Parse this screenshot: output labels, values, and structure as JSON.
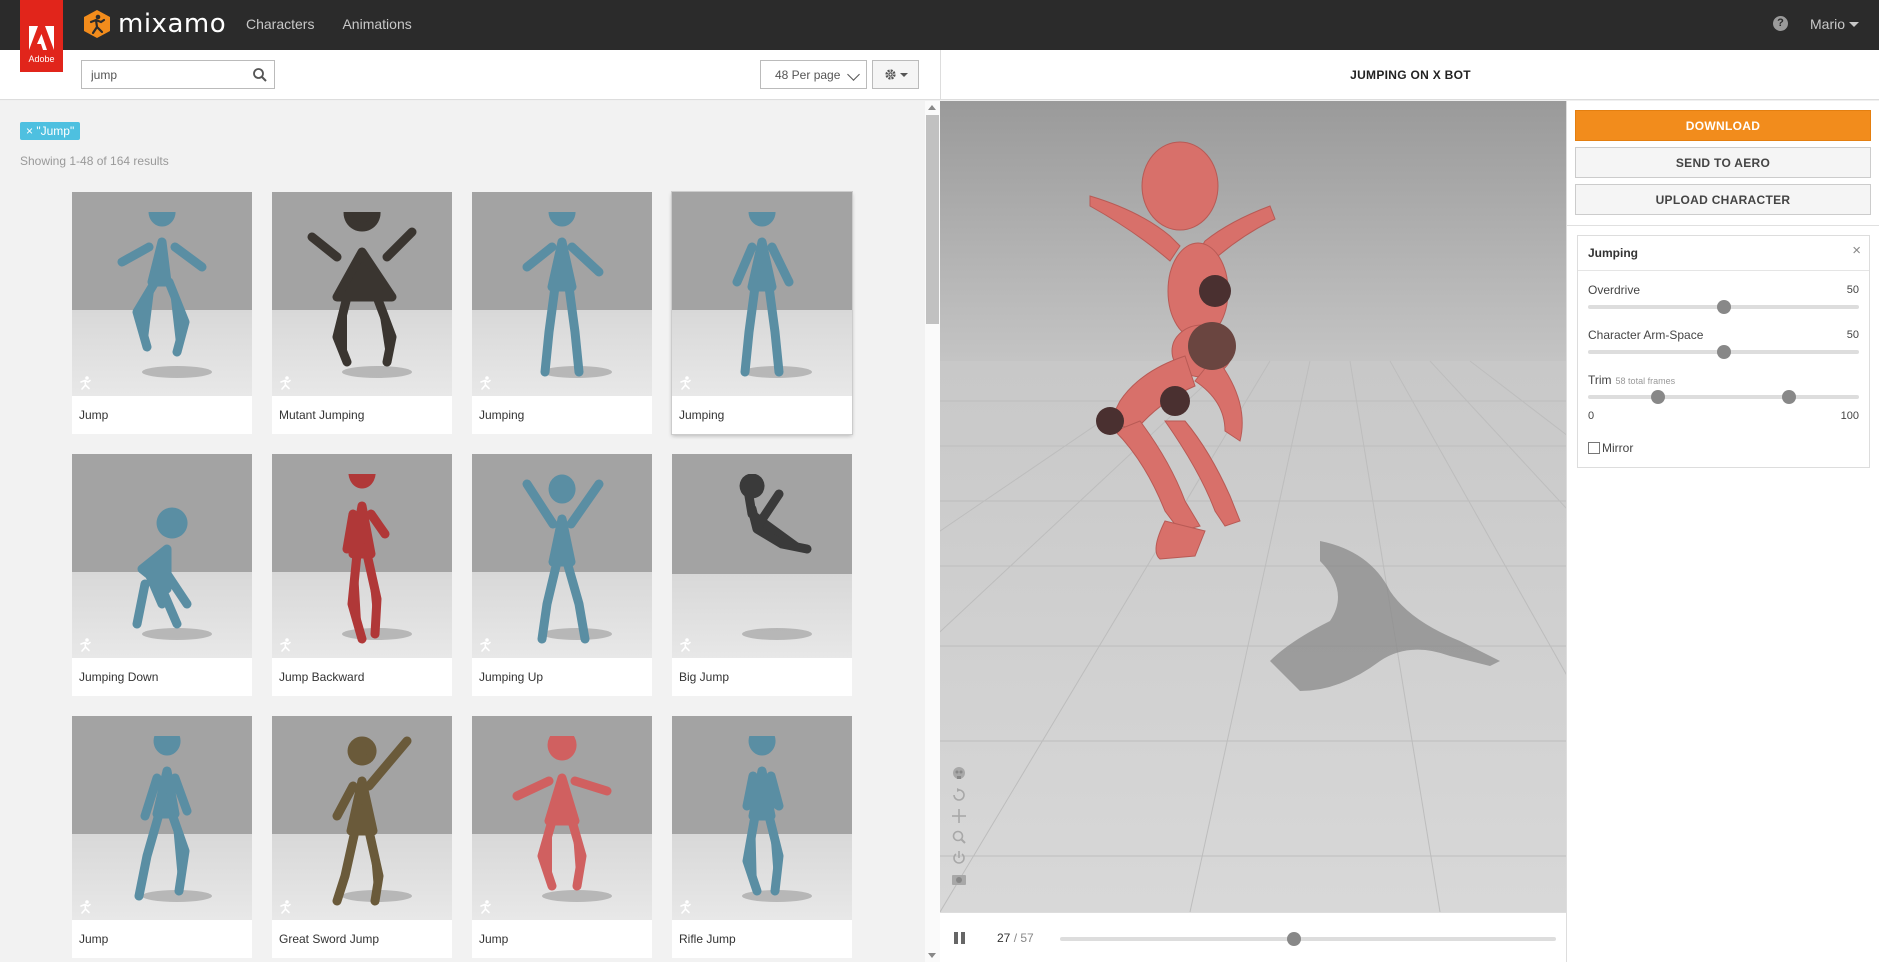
{
  "brand": {
    "adobe_label": "Adobe",
    "app_name": "mixamo",
    "colors": {
      "adobe_red": "#e1251b",
      "accent_orange": "#f28c1c",
      "tag_blue": "#4ec0e0",
      "topbar": "#2b2b2b"
    }
  },
  "nav": {
    "characters": "Characters",
    "animations": "Animations"
  },
  "header": {
    "help_label": "?",
    "user_name": "Mario"
  },
  "toolbar": {
    "search_value": "jump",
    "per_page": "48 Per page"
  },
  "filter": {
    "tag": "× \"Jump\"",
    "results": "Showing 1-48 of 164 results"
  },
  "grid": {
    "items": [
      {
        "name": "Jump",
        "selected": false,
        "color": "#5a8ea3"
      },
      {
        "name": "Mutant Jumping",
        "selected": false,
        "color": "#3a3530"
      },
      {
        "name": "Jumping",
        "selected": false,
        "color": "#5a8ea3"
      },
      {
        "name": "Jumping",
        "selected": true,
        "color": "#5a8ea3"
      },
      {
        "name": "Jumping Down",
        "selected": false,
        "color": "#5a8ea3"
      },
      {
        "name": "Jump Backward",
        "selected": false,
        "color": "#b03838"
      },
      {
        "name": "Jumping Up",
        "selected": false,
        "color": "#5a8ea3"
      },
      {
        "name": "Big Jump",
        "selected": false,
        "color": "#3a3a3a"
      },
      {
        "name": "Jump",
        "selected": false,
        "color": "#5a8ea3"
      },
      {
        "name": "Great Sword Jump",
        "selected": false,
        "color": "#6a5a3a"
      },
      {
        "name": "Jump",
        "selected": false,
        "color": "#d06060"
      },
      {
        "name": "Rifle Jump",
        "selected": false,
        "color": "#5a8ea3"
      }
    ]
  },
  "preview": {
    "title": "JUMPING ON X BOT",
    "current_frame": "27",
    "total_frames": "/ 57",
    "progress": 0.47
  },
  "actions": {
    "download": "DOWNLOAD",
    "send_aero": "SEND TO AERO",
    "upload": "UPLOAD CHARACTER"
  },
  "params": {
    "title": "Jumping",
    "close": "×",
    "overdrive": {
      "label": "Overdrive",
      "value": "50",
      "fraction": 0.5
    },
    "arm_space": {
      "label": "Character Arm-Space",
      "value": "50",
      "fraction": 0.5
    },
    "trim": {
      "label": "Trim",
      "sub": "58 total frames",
      "min": "0",
      "max": "100",
      "start_fraction": 0.26,
      "end_fraction": 0.74
    },
    "mirror": "Mirror"
  }
}
